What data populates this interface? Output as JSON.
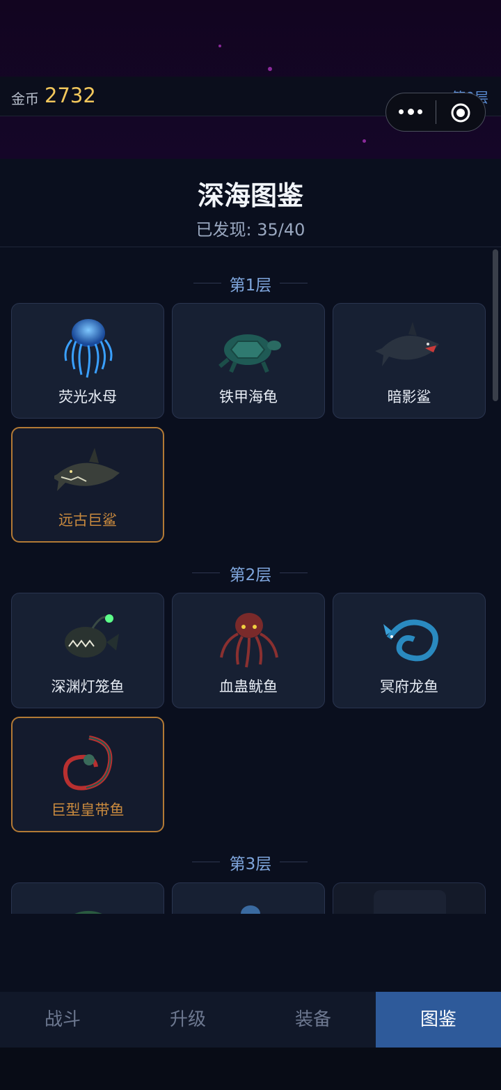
{
  "status": {
    "gold_label": "金币",
    "gold_value": "2732",
    "floor_label": "第9层"
  },
  "panel": {
    "title": "深海图鉴",
    "discovered": "已发现: 35/40"
  },
  "layers": [
    {
      "label": "第1层",
      "creatures": [
        {
          "name": "荧光水母",
          "icon": "jellyfish-icon",
          "rare": false
        },
        {
          "name": "铁甲海龟",
          "icon": "turtle-icon",
          "rare": false
        },
        {
          "name": "暗影鲨",
          "icon": "shark-icon",
          "rare": false
        },
        {
          "name": "远古巨鲨",
          "icon": "ancient-shark-icon",
          "rare": true
        }
      ]
    },
    {
      "label": "第2层",
      "creatures": [
        {
          "name": "深渊灯笼鱼",
          "icon": "anglerfish-icon",
          "rare": false
        },
        {
          "name": "血蛊鱿鱼",
          "icon": "octopus-icon",
          "rare": false
        },
        {
          "name": "冥府龙鱼",
          "icon": "dragonfish-icon",
          "rare": false
        },
        {
          "name": "巨型皇带鱼",
          "icon": "oarfish-icon",
          "rare": true
        }
      ]
    },
    {
      "label": "第3层",
      "creatures": [
        {
          "name": "",
          "icon": "sea-monster-icon",
          "rare": false
        },
        {
          "name": "",
          "icon": "octopus-icon",
          "rare": false
        },
        {
          "name": "",
          "icon": "locked-icon",
          "rare": false
        }
      ]
    }
  ],
  "tabs": [
    {
      "label": "战斗",
      "active": false
    },
    {
      "label": "升级",
      "active": false
    },
    {
      "label": "装备",
      "active": false
    },
    {
      "label": "图鉴",
      "active": true
    }
  ],
  "colors": {
    "accent_gold": "#f2c75c",
    "rare_border": "#b37a35",
    "active_tab": "#2e5a9a",
    "layer_label": "#7fa6dd"
  }
}
